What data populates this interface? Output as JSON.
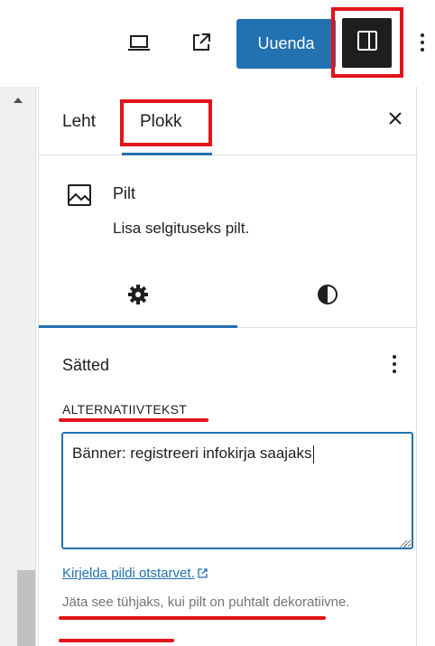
{
  "toolbar": {
    "preview_icon": "laptop-icon",
    "view_icon": "external-link-icon",
    "update_label": "Uuenda",
    "settings_icon": "sidebar-toggle-icon",
    "options_icon": "vertical-ellipsis-icon",
    "highlight_color": "#e3131b",
    "accent_color": "#2271b1"
  },
  "sidebar": {
    "tabs": [
      {
        "label": "Leht"
      },
      {
        "label": "Plokk",
        "active": true
      }
    ],
    "close_icon": "close-icon",
    "block": {
      "icon": "image-icon",
      "title": "Pilt",
      "description": "Lisa selgituseks pilt."
    },
    "subtabs": [
      {
        "icon": "gear-icon",
        "active": true
      },
      {
        "icon": "contrast-icon"
      }
    ],
    "settings": {
      "heading": "Sätted",
      "options_icon": "vertical-ellipsis-icon",
      "alt_label": "ALTERNATIIVTEKST",
      "alt_value": "Bänner: registreeri infokirja saajaks",
      "help_link": "Kirjelda pildi otstarvet.",
      "help_text": "Jäta see tühjaks, kui pilt on puhtalt dekoratiivne."
    }
  }
}
